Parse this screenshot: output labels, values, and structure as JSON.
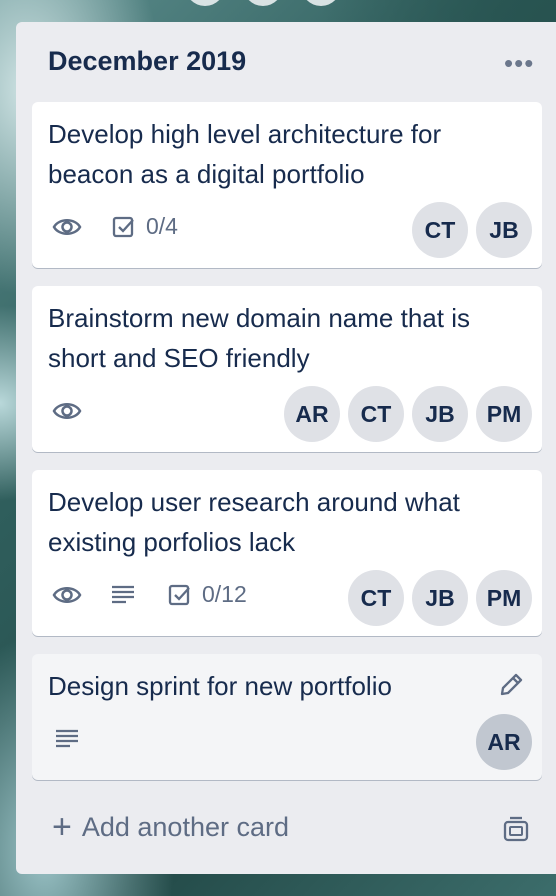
{
  "list": {
    "title": "December 2019",
    "menu_icon": "more-horizontal-icon",
    "cards": [
      {
        "title": "Develop high level architecture for beacon as a digital portfolio",
        "watching": true,
        "checklist": "0/4",
        "members": [
          "CT",
          "JB"
        ]
      },
      {
        "title": "Brainstorm new domain name that is short and SEO friendly",
        "watching": true,
        "members": [
          "AR",
          "CT",
          "JB",
          "PM"
        ]
      },
      {
        "title": "Develop user research around what existing porfolios lack",
        "watching": true,
        "description": true,
        "checklist": "0/12",
        "members": [
          "CT",
          "JB",
          "PM"
        ]
      },
      {
        "title": "Design sprint for new portfolio",
        "description": true,
        "edit_icon": "pencil-icon",
        "members": [
          "AR"
        ]
      }
    ],
    "add_card_label": "Add another card",
    "template_icon": "card-template-icon"
  },
  "colors": {
    "list_bg": "#ebecf0",
    "card_bg": "#ffffff",
    "text": "#172b4d",
    "muted": "#5e6c84",
    "avatar_bg": "#dfe1e6"
  }
}
